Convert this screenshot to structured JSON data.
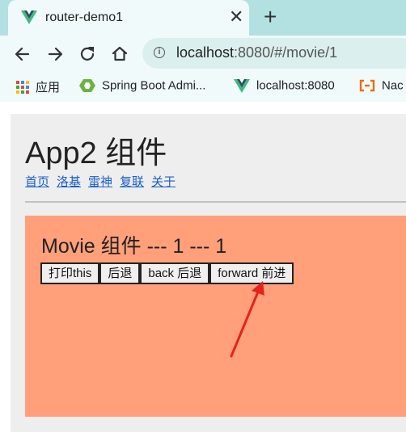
{
  "browser": {
    "tab": {
      "title": "router-demo1",
      "favicon": "vue-logo-icon",
      "close_glyph": "✕"
    },
    "new_tab_glyph": "+",
    "address": {
      "host": "localhost",
      "rest": ":8080/#/movie/1"
    },
    "nav_icons": [
      "back-arrow-icon",
      "forward-arrow-icon",
      "reload-icon",
      "home-icon"
    ],
    "bookmarks": [
      {
        "label": "应用",
        "icon": "apps-grid-icon"
      },
      {
        "label": "Spring Boot Admi...",
        "icon": "spring-boot-admin-icon"
      },
      {
        "label": "localhost:8080",
        "icon": "vue-logo-icon"
      },
      {
        "label": "Nac",
        "icon": "nacos-icon"
      }
    ]
  },
  "app": {
    "title": "App2 组件",
    "nav_links": [
      "首页",
      "洛基",
      "雷神",
      "复联",
      "关于"
    ]
  },
  "movie": {
    "title": "Movie 组件 --- 1 --- 1",
    "buttons": [
      "打印this",
      "后退",
      "back 后退",
      "forward 前进"
    ]
  },
  "annotation": {
    "arrow_color": "#e8211b"
  },
  "colors": {
    "tab_strip": "#b3e0e0",
    "toolbar": "#f0fafa",
    "app_box": "#eeeeee",
    "movie_box": "#ffa07a",
    "link": "#1a5fc8",
    "vue_green": "#41b883",
    "vue_dark": "#34495e"
  }
}
